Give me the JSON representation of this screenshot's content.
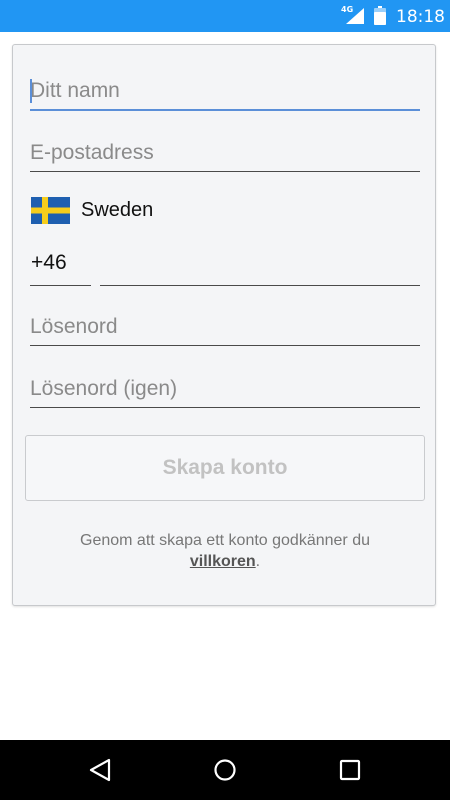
{
  "status_bar": {
    "network_label": "4G",
    "time": "18:18",
    "background_color": "#2196f3",
    "signal_icon": "signal-icon",
    "battery_icon": "battery-icon"
  },
  "form": {
    "name_placeholder": "Ditt namn",
    "name_value": "",
    "email_placeholder": "E-postadress",
    "email_value": "",
    "country": {
      "name": "Sweden",
      "flag_icon": "sweden-flag-icon"
    },
    "dial_code": "+46",
    "phone_value": "",
    "password_placeholder": "Lösenord",
    "password_confirm_placeholder": "Lösenord (igen)",
    "submit_label": "Skapa konto",
    "terms_text": "Genom att skapa ett konto godkänner du",
    "terms_link": "villkoren",
    "terms_suffix": "."
  },
  "nav_bar": {
    "back_icon": "back-triangle-icon",
    "home_icon": "home-circle-icon",
    "recents_icon": "recents-square-icon"
  },
  "colors": {
    "accent": "#5b8fd8",
    "card_background": "#f4f5f7",
    "disabled_text": "#c2c2c2"
  }
}
